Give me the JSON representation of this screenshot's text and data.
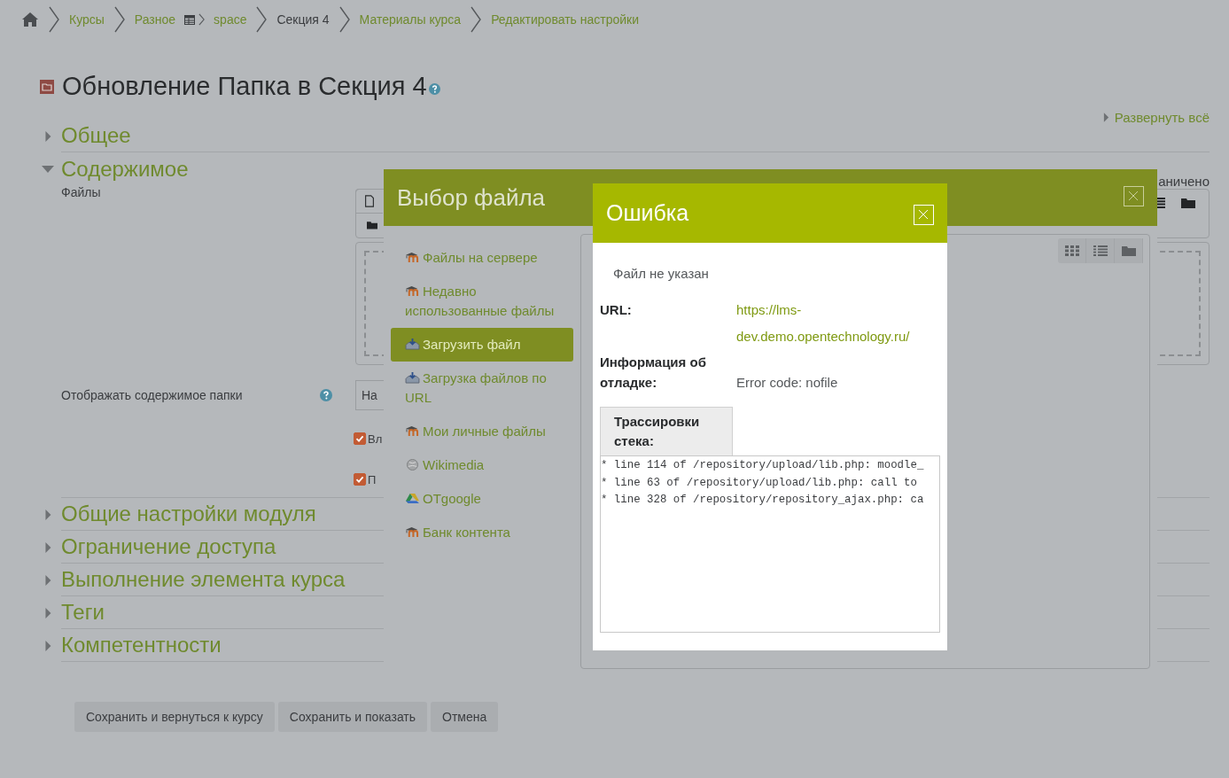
{
  "breadcrumb": [
    {
      "label": "Курсы",
      "kind": "link"
    },
    {
      "label": "Разное",
      "kind": "link"
    },
    {
      "label": "space",
      "kind": "course"
    },
    {
      "label": "Секция 4",
      "kind": "text"
    },
    {
      "label": "Материалы курса",
      "kind": "link"
    },
    {
      "label": "Редактировать настройки",
      "kind": "link"
    }
  ],
  "page_title": "Обновление Папка в Секция 4",
  "expand_all": "Развернуть всё",
  "sections": [
    {
      "title": "Общее",
      "expanded": false
    },
    {
      "title": "Содержимое",
      "expanded": true,
      "fields": {
        "files_label": "Файлы",
        "limit_text": "аничено",
        "display_label": "Отображать содержимое папки",
        "display_value": "На",
        "checkboxes": [
          {
            "label": "Вл",
            "checked": true
          },
          {
            "label": "П",
            "checked": true
          }
        ]
      }
    },
    {
      "title": "Общие настройки модуля",
      "expanded": false
    },
    {
      "title": "Ограничение доступа",
      "expanded": false
    },
    {
      "title": "Выполнение элемента курса",
      "expanded": false
    },
    {
      "title": "Теги",
      "expanded": false
    },
    {
      "title": "Компетентности",
      "expanded": false
    }
  ],
  "buttons": [
    "Сохранить и вернуться к курсу",
    "Сохранить и показать",
    "Отмена"
  ],
  "picker": {
    "title": "Выбор файла",
    "repositories": [
      {
        "label": "Файлы на сервере",
        "kind": "moodle",
        "selected": false
      },
      {
        "label": "Недавно использованные файлы",
        "kind": "moodle",
        "selected": false
      },
      {
        "label": "Загрузить файл",
        "kind": "upload",
        "selected": true
      },
      {
        "label": "Загрузка файлов по URL",
        "kind": "upload",
        "selected": false
      },
      {
        "label": "Мои личные файлы",
        "kind": "moodle",
        "selected": false
      },
      {
        "label": "Wikimedia",
        "kind": "wikimedia",
        "selected": false
      },
      {
        "label": "OTgoogle",
        "kind": "gdrive",
        "selected": false
      },
      {
        "label": "Банк контента",
        "kind": "moodle",
        "selected": false
      }
    ]
  },
  "error": {
    "title": "Ошибка",
    "message": "Файл не указан",
    "url_label": "URL:",
    "url": "https://lms-dev.demo.opentechnology.ru/",
    "debug_label": "Информация об отладке:",
    "debug_value": "Error code: nofile",
    "trace_label": "Трассировки стека:",
    "trace": [
      "* line 114 of /repository/upload/lib.php: moodle_",
      "* line 63 of /repository/upload/lib.php: call to",
      "* line 328 of /repository/repository_ajax.php: ca"
    ]
  }
}
